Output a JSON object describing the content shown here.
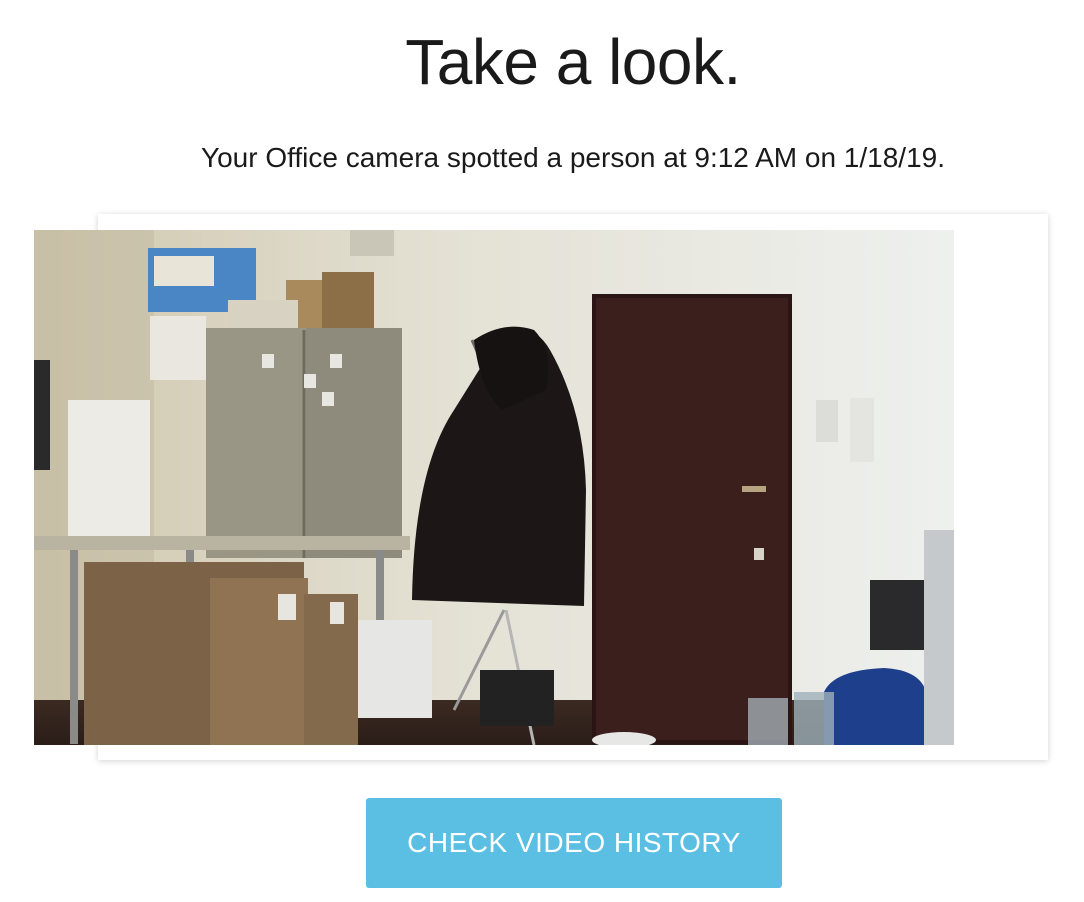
{
  "header": {
    "title": "Take a look."
  },
  "message": {
    "text": "Your Office camera spotted a person at 9:12 AM on 1/18/19."
  },
  "snapshot": {
    "alt": "Office camera snapshot"
  },
  "actions": {
    "check_video_history_label": "CHECK VIDEO HISTORY"
  },
  "colors": {
    "button_bg": "#5bbfe4",
    "button_text": "#ffffff",
    "text": "#1a1a1a"
  }
}
